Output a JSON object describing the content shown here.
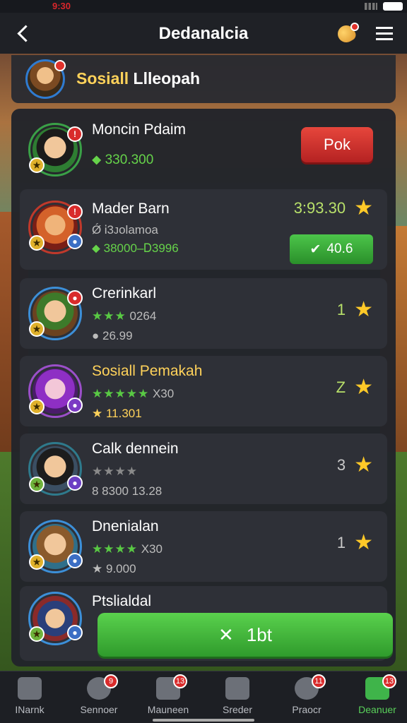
{
  "status": {
    "time": "9:30"
  },
  "appbar": {
    "title": "Dedanalcia"
  },
  "header": {
    "title_highlight": "Sosiall",
    "title_rest": "Llleopah"
  },
  "rows": [
    {
      "name": "Moncin Pdaim",
      "line1": "330.300",
      "button": "Pok"
    },
    {
      "name": "Mader Barn",
      "line1": "Ǿ Ꭵ3ᴊᴏlamoa",
      "line2": "38000–Ꭰ3996",
      "score": "3:93.30",
      "button": "40.6"
    },
    {
      "name": "Crerinkarl",
      "stars": "★★★",
      "line1_value": "0264",
      "line2": "26.99",
      "rank": "1"
    },
    {
      "name": "Sosiall Pemakah",
      "stars": "★★★★★",
      "line1_value": "X30",
      "line2": "11.301",
      "rank": "Z"
    },
    {
      "name": "Calk dennein",
      "stars": "★★★★",
      "line2": "8 8300 13.28",
      "rank": "3"
    },
    {
      "name": "Dnenialan",
      "stars": "★★★★",
      "line1_value": "X30",
      "line2": "9.000",
      "rank": "1"
    },
    {
      "name": "Ptslialdal",
      "button": "1bt"
    }
  ],
  "nav": [
    {
      "label": "INarnk",
      "badge": "",
      "icon": "home-icon"
    },
    {
      "label": "Sennoer",
      "badge": "9",
      "icon": "emblem-icon"
    },
    {
      "label": "Mauneen",
      "badge": "13",
      "icon": "shop-icon"
    },
    {
      "label": "Sreder",
      "badge": "",
      "icon": "trophy-icon"
    },
    {
      "label": "Praocr",
      "badge": "11",
      "icon": "profile-icon"
    },
    {
      "label": "Deanuer",
      "badge": "13",
      "icon": "chest-icon"
    }
  ],
  "colors": {
    "accent_green": "#3fb44a",
    "accent_red": "#d92b2b",
    "gold": "#ffd25a"
  }
}
